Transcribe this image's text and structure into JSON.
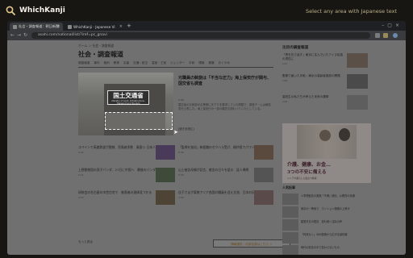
{
  "app": {
    "title": "WhichKanji",
    "hint": "Select any area with Japanese text",
    "colors": {
      "background": "#181612",
      "hint": "#bbb08c",
      "selection": "#f5f5f5"
    }
  },
  "browser": {
    "tabs": [
      {
        "label": "社会・調査報道：朝日新聞",
        "active": true
      },
      {
        "label": "WhichKanji - Japanese Vi",
        "active": false
      }
    ],
    "new_tab": "+",
    "url": "asahi.com/national/list/?iref=pc_gnavi",
    "nav": {
      "back": "←",
      "forward": "→",
      "reload": "↻"
    }
  },
  "page": {
    "breadcrumb": "ホーム ＞ 社会・調査報道",
    "section_title": "社会・調査報道",
    "nav_links": [
      "調査報道",
      "事件",
      "裁判",
      "教育",
      "災害",
      "交通・航空",
      "皇室・王室",
      "ジェンダー",
      "平和",
      "環境",
      "健康",
      "おくやみ"
    ],
    "hero": {
      "sign_text": "国土交通省",
      "sign_sub": "Ministry of Land, Infrastructure, Transport and Tourism",
      "lead_title": "元職員の斡旋は「不当な圧力」海上保安庁が関与、国交省も調査",
      "lead_time": "6:00",
      "lead_body": "国交省の元幹部が企業側に天下りを要求していた問題で、調査チームは報告書を公表した。海上保安庁の一部の職員も関わっていたとしている。",
      "lead_more": "[続きを読む]"
    },
    "stories": [
      {
        "title": "スペインで高速鉄道が脱線、死傷者多数　乗客ら 日本人の情報は",
        "time": "5:41"
      },
      {
        "title": "「監視を強化」新組織のセクハラ受け、福井県でパワハラ調査",
        "time": "5:30"
      },
      {
        "title": "上野動物園の双子パンダ、27日に中国へ　最後のパンダ外交に",
        "time": "5:11"
      },
      {
        "title": "山上被告母親が証言、献金の日々を語る　証人尋問",
        "time": "5:00"
      },
      {
        "title": "研修会の名古屋の市営住宅で　被害者の遺体見つかる",
        "time": "4:52"
      },
      {
        "title": "佳子さまが東南アジア各国の職員を迎え交流、日本の伝統文化",
        "time": "4:30"
      }
    ],
    "more_link": "もっと見る",
    "ad_bar": "情報提供・内部告発はこちら ＞",
    "footer_label": "連載"
  },
  "sidebar": {
    "title": "注目の調査報道",
    "items": [
      {
        "title": "「恩を仇で返す」東京に住んでいたアイヌ民族の男性に",
        "date": "1/27"
      },
      {
        "title": "郵便で届いた手紙…東京の高齢者施設の問題",
        "date": "1/26"
      },
      {
        "title": "高校生の私たちが考えた未来の選挙",
        "date": "1/25"
      }
    ],
    "ad": {
      "copy1": "介護、健康、お金…",
      "copy2": "3つの不安に備える",
      "small": "シニアの暮らしに役立つ情報"
    },
    "rank_title": "人気記事",
    "rank_items": [
      "人事院勧告の実施「不満」続出、公務員の待遇",
      "東京の一等地で　マンション価格の上昇が",
      "能登半島の復旧　遅れ続く住民の声",
      "「何気なく」SNS投稿から広がる誤情報",
      "時代の変化の中で変わらないもの"
    ]
  }
}
